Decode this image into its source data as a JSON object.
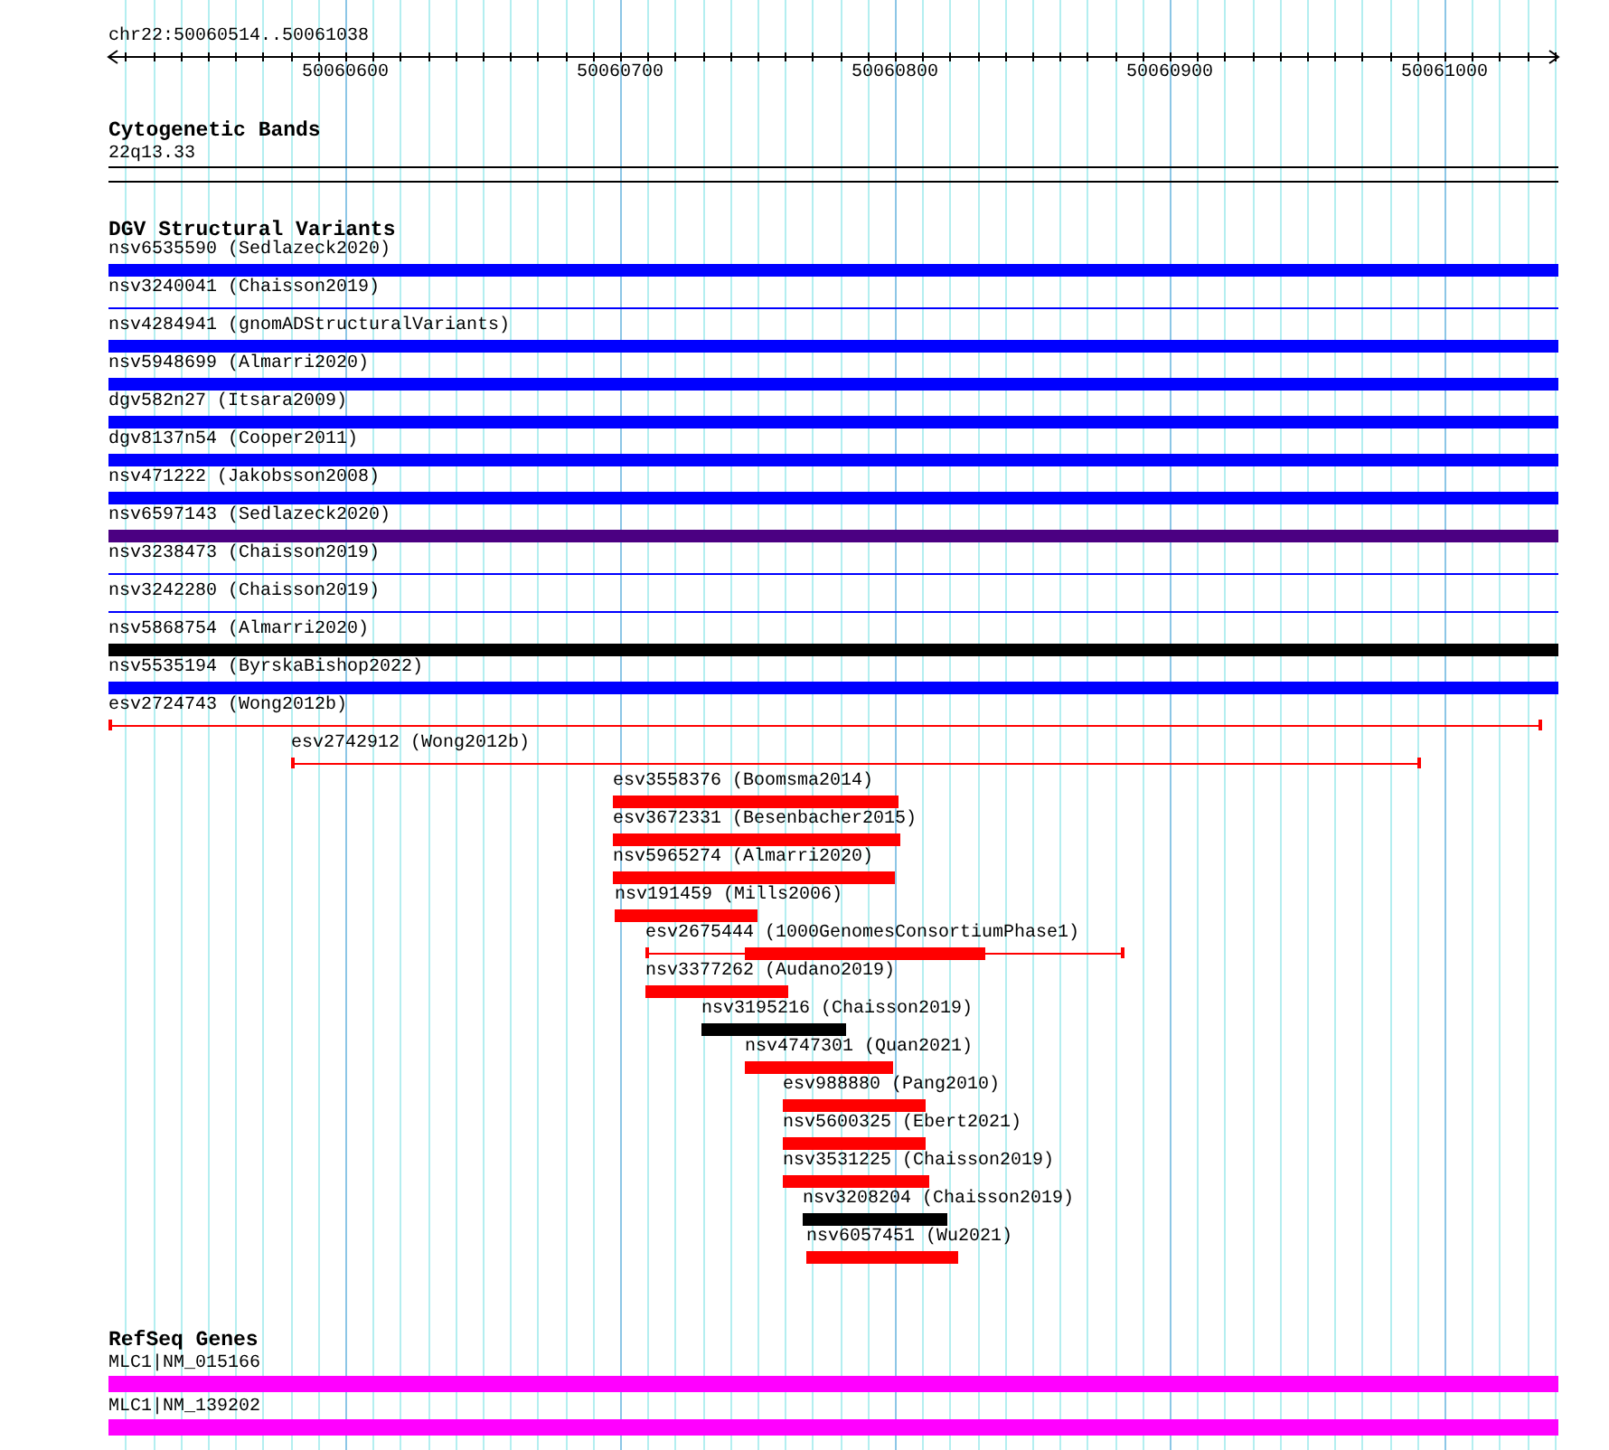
{
  "ruler": {
    "location": "chr22:50060514..50061038",
    "ticks": [
      "50060600",
      "50060700",
      "50060800",
      "50060900",
      "50061000"
    ]
  },
  "tracks": [
    {
      "title": "Cytogenetic Bands",
      "features": [
        {
          "label": "22q13.33",
          "kind": "band",
          "color": "#000000"
        }
      ]
    },
    {
      "title": "DGV Structural Variants",
      "features": [
        {
          "label": "nsv6535590 (Sedlazeck2020)",
          "kind": "bar",
          "color": "#0000ff"
        },
        {
          "label": "nsv3240041 (Chaisson2019)",
          "kind": "line",
          "color": "#0000ff"
        },
        {
          "label": "nsv4284941 (gnomADStructuralVariants)",
          "kind": "bar",
          "color": "#0000ff"
        },
        {
          "label": "nsv5948699 (Almarri2020)",
          "kind": "bar",
          "color": "#0000ff"
        },
        {
          "label": "dgv582n27 (Itsara2009)",
          "kind": "bar",
          "color": "#0000ff"
        },
        {
          "label": "dgv8137n54 (Cooper2011)",
          "kind": "bar",
          "color": "#0000ff"
        },
        {
          "label": "nsv471222 (Jakobsson2008)",
          "kind": "bar",
          "color": "#0000ff"
        },
        {
          "label": "nsv6597143 (Sedlazeck2020)",
          "kind": "bar",
          "color": "#4b0082"
        },
        {
          "label": "nsv3238473 (Chaisson2019)",
          "kind": "line",
          "color": "#0000ff"
        },
        {
          "label": "nsv3242280 (Chaisson2019)",
          "kind": "line",
          "color": "#0000ff"
        },
        {
          "label": "nsv5868754 (Almarri2020)",
          "kind": "bar",
          "color": "#000000"
        },
        {
          "label": "nsv5535194 (ByrskaBishop2022)",
          "kind": "bar",
          "color": "#0000ff"
        },
        {
          "label": "esv2724743 (Wong2012b)",
          "kind": "capped",
          "color": "#ff0000"
        },
        {
          "label": "esv2742912 (Wong2012b)",
          "kind": "capped",
          "color": "#ff0000"
        },
        {
          "label": "esv3558376 (Boomsma2014)",
          "kind": "bar",
          "color": "#ff0000"
        },
        {
          "label": "esv3672331 (Besenbacher2015)",
          "kind": "bar",
          "color": "#ff0000"
        },
        {
          "label": "nsv5965274 (Almarri2020)",
          "kind": "bar",
          "color": "#ff0000"
        },
        {
          "label": "nsv191459 (Mills2006)",
          "kind": "bar",
          "color": "#ff0000"
        },
        {
          "label": "esv2675444 (1000GenomesConsortiumPhase1)",
          "kind": "capped-core",
          "color": "#ff0000"
        },
        {
          "label": "nsv3377262 (Audano2019)",
          "kind": "bar",
          "color": "#ff0000"
        },
        {
          "label": "nsv3195216 (Chaisson2019)",
          "kind": "bar",
          "color": "#000000"
        },
        {
          "label": "nsv4747301 (Quan2021)",
          "kind": "bar",
          "color": "#ff0000"
        },
        {
          "label": "esv988880 (Pang2010)",
          "kind": "bar",
          "color": "#ff0000"
        },
        {
          "label": "nsv5600325 (Ebert2021)",
          "kind": "bar",
          "color": "#ff0000"
        },
        {
          "label": "nsv3531225 (Chaisson2019)",
          "kind": "bar",
          "color": "#ff0000"
        },
        {
          "label": "nsv3208204 (Chaisson2019)",
          "kind": "bar",
          "color": "#000000"
        },
        {
          "label": "nsv6057451 (Wu2021)",
          "kind": "bar",
          "color": "#ff0000"
        }
      ]
    },
    {
      "title": "RefSeq Genes",
      "features": [
        {
          "label": "MLC1|NM_015166",
          "kind": "gene",
          "color": "#ff00ff"
        },
        {
          "label": "MLC1|NM_139202",
          "kind": "gene",
          "color": "#ff00ff"
        }
      ]
    }
  ]
}
